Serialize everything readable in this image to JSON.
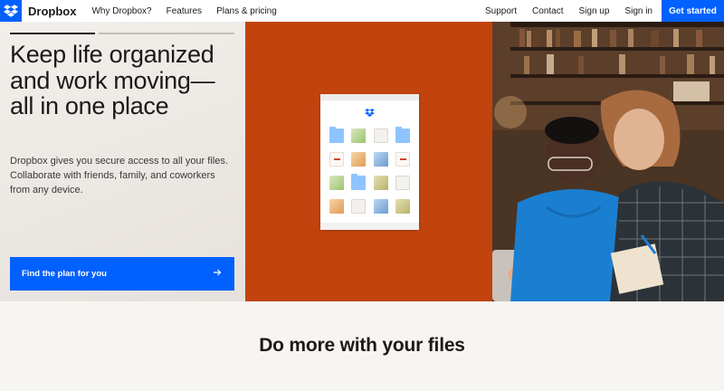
{
  "nav": {
    "brand": "Dropbox",
    "links_left": [
      "Why Dropbox?",
      "Features",
      "Plans & pricing"
    ],
    "links_right": [
      "Support",
      "Contact",
      "Sign up",
      "Sign in"
    ],
    "cta": "Get started"
  },
  "hero": {
    "title": "Keep life organized and work moving—all in one place",
    "subtitle": "Dropbox gives you secure access to all your files. Collaborate with friends, family, and coworkers from any device.",
    "button_label": "Find the plan for you",
    "icons": {
      "button": "arrow-right-icon",
      "logo": "dropbox-logo-icon"
    }
  },
  "section": {
    "title": "Do more with your files"
  },
  "colors": {
    "brand_blue": "#0061fe",
    "orange": "#c1440e",
    "text": "#1e1919",
    "background": "#f7f5f2"
  }
}
